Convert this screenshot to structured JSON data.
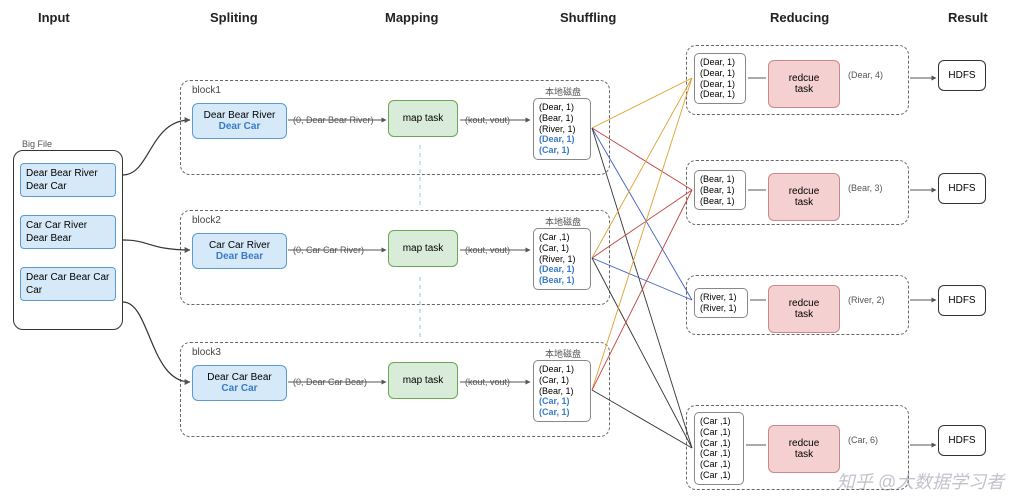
{
  "stages": {
    "input": "Input",
    "splitting": "Spliting",
    "mapping": "Mapping",
    "shuffling": "Shuffling",
    "reducing": "Reducing",
    "result": "Result"
  },
  "bigfile": {
    "title": "Big File",
    "rows": [
      "Dear Bear River\nDear Car",
      "Car Car River\nDear Bear",
      "Dear Car Bear\nCar Car"
    ]
  },
  "blocks": [
    {
      "label": "block1",
      "text_top": "Dear Bear River",
      "text_bottom": "Dear Car",
      "kv_out": "(0, Dear Bear River)",
      "map_label": "map task",
      "kv_pair": "(kout, vout)",
      "local_label": "本地磁盘",
      "output": [
        "(Dear, 1)",
        "(Bear, 1)",
        "(River, 1)",
        "(Dear, 1)",
        "(Car, 1)"
      ],
      "output_blue": [
        3,
        4
      ]
    },
    {
      "label": "block2",
      "text_top": "Car Car River",
      "text_bottom": "Dear Bear",
      "kv_out": "(0, Car Car River)",
      "map_label": "map task",
      "kv_pair": "(kout, vout)",
      "local_label": "本地磁盘",
      "output": [
        "(Car ,1)",
        "(Car, 1)",
        "(River, 1)",
        "(Dear, 1)",
        "(Bear, 1)"
      ],
      "output_blue": [
        3,
        4
      ]
    },
    {
      "label": "block3",
      "text_top": "Dear Car Bear",
      "text_bottom": "Car Car",
      "kv_out": "(0, Dear Car Bear)",
      "map_label": "map task",
      "kv_pair": "(kout, vout)",
      "local_label": "本地磁盘",
      "output": [
        "(Dear, 1)",
        "(Car, 1)",
        "(Bear, 1)",
        "(Car, 1)",
        "(Car, 1)"
      ],
      "output_blue": [
        3,
        4
      ]
    }
  ],
  "shuffle": [
    {
      "items": [
        "(Dear, 1)",
        "(Dear, 1)",
        "(Dear, 1)",
        "(Dear, 1)"
      ]
    },
    {
      "items": [
        "(Bear, 1)",
        "(Bear, 1)",
        "(Bear, 1)"
      ]
    },
    {
      "items": [
        "(River, 1)",
        "(River, 1)"
      ]
    },
    {
      "items": [
        "(Car ,1)",
        "(Car ,1)",
        "(Car ,1)",
        "(Car ,1)",
        "(Car ,1)",
        "(Car ,1)"
      ]
    }
  ],
  "reduce": [
    {
      "label": "redcue task",
      "result": "(Dear, 4)"
    },
    {
      "label": "redcue task",
      "result": "(Bear, 3)"
    },
    {
      "label": "redcue task",
      "result": "(River, 2)"
    },
    {
      "label": "redcue task",
      "result": "(Car, 6)"
    }
  ],
  "hdfs": "HDFS",
  "watermark": "知乎 @大数据学习者"
}
